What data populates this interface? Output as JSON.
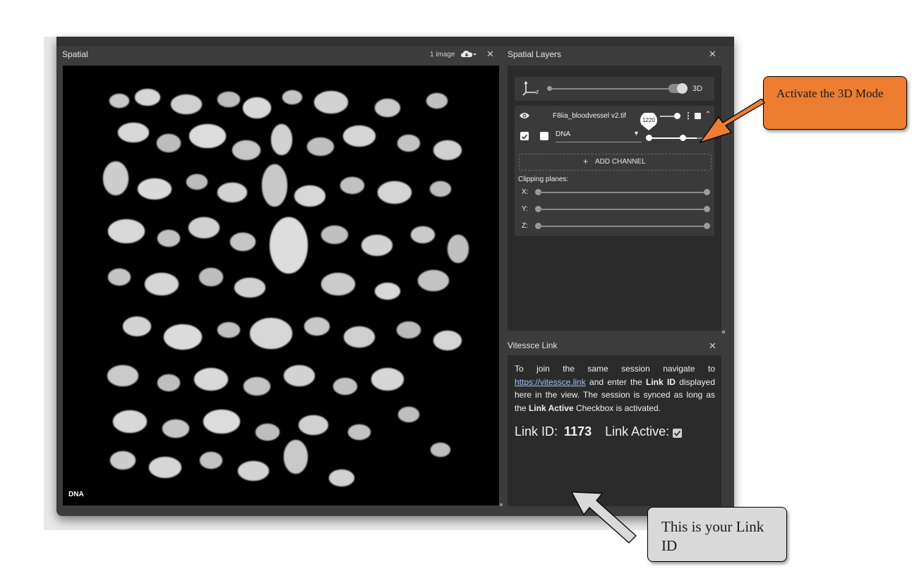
{
  "spatial": {
    "title": "Spatial",
    "image_count": "1 image",
    "channel_label": "DNA"
  },
  "layers": {
    "title": "Spatial Layers",
    "mode_3d_label": "3D",
    "layer_name": "F8iia_bloodvessel v2.tif",
    "channel_name": "DNA",
    "slider_tooltip": "1220",
    "add_channel_label": "ADD CHANNEL",
    "clipping_label": "Clipping planes:",
    "axes": [
      "X:",
      "Y:",
      "Z:"
    ]
  },
  "vlink": {
    "title": "Vitessce Link",
    "text_1": "To join the same session navigate to",
    "link_url": "https://vitessce.link",
    "text_2": " and enter the ",
    "bold_link_id": "Link ID",
    "text_3": " displayed here in the view. The session is synced as long as the ",
    "bold_link_active": "Link Active",
    "text_4": " Checkbox is activated.",
    "link_id_label": "Link ID:",
    "link_id_value": "1173",
    "link_active_label": "Link Active:"
  },
  "callouts": {
    "activate_3d": "Activate the 3D Mode",
    "link_id_note": "This is your Link ID"
  },
  "colors": {
    "callout_orange": "#ED7D31",
    "callout_gray": "#D9D9D9",
    "window_bg": "#3c3c3c",
    "panel_bg": "#2b2b2b"
  }
}
